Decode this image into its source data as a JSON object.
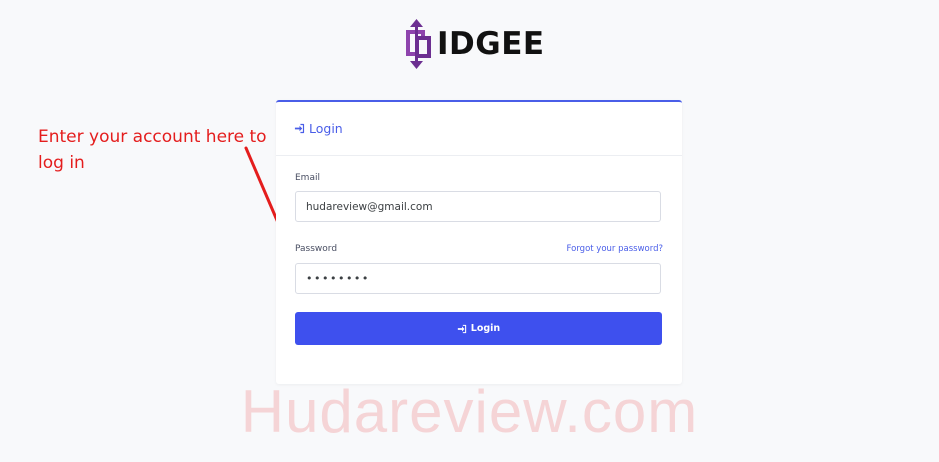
{
  "brand": {
    "name": "IDGEE",
    "accent_color": "#4a5ee8",
    "logo_icon": "purple-arrow-logo-icon"
  },
  "login_card": {
    "header_title": "Login",
    "header_icon": "sign-in-icon",
    "email_label": "Email",
    "email_value": "hudareview@gmail.com",
    "password_label": "Password",
    "password_value": "••••••••",
    "forgot_password_link": "Forgot your password?",
    "submit_label": "Login",
    "submit_color": "#3e50ee"
  },
  "annotation": {
    "text": "Enter your account here to log in",
    "color": "#e41d1d"
  },
  "watermark": {
    "text": "Hudareview.com"
  }
}
